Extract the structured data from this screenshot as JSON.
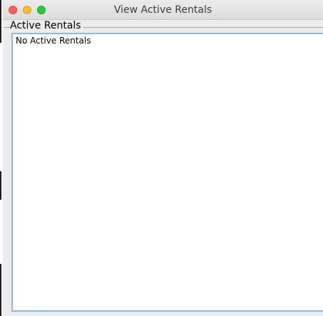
{
  "window": {
    "title": "View Active Rentals"
  },
  "group": {
    "title": "Active Rentals"
  },
  "list": {
    "empty_message": "No Active Rentals"
  },
  "colors": {
    "close": "#fc5f57",
    "minimize": "#fdbb2e",
    "zoom": "#28c840",
    "focus_border": "#8db9de"
  }
}
